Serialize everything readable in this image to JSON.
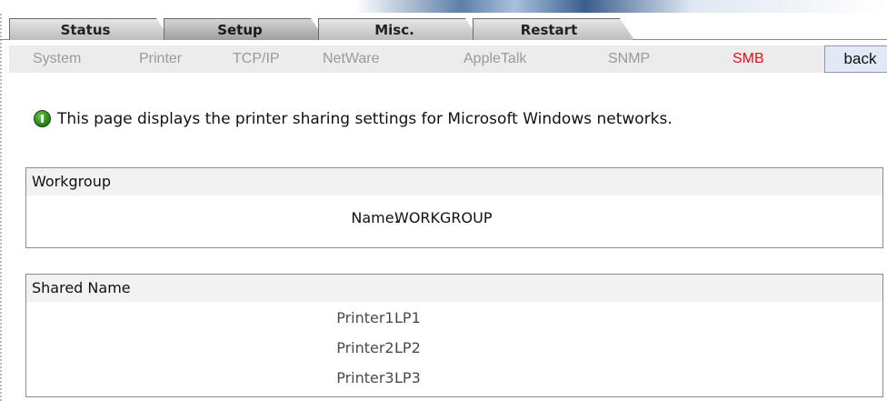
{
  "tabs": [
    {
      "label": "Status",
      "active": false
    },
    {
      "label": "Setup",
      "active": true
    },
    {
      "label": "Misc.",
      "active": false
    },
    {
      "label": "Restart",
      "active": false
    }
  ],
  "subnav": {
    "items": [
      "System",
      "Printer",
      "TCP/IP",
      "NetWare",
      "AppleTalk",
      "SNMP",
      "SMB"
    ],
    "current": "SMB",
    "back_label": "back"
  },
  "info": {
    "icon": "info-icon",
    "text": "This page displays the printer sharing settings for Microsoft Windows networks."
  },
  "workgroup": {
    "title": "Workgroup",
    "name_label": "Name:",
    "name_value": "WORKGROUP"
  },
  "shared": {
    "title": "Shared Name",
    "printers": [
      {
        "label": "Printer1:",
        "value": "LP1"
      },
      {
        "label": "Printer2:",
        "value": "LP2"
      },
      {
        "label": "Printer3:",
        "value": "LP3"
      }
    ]
  },
  "colors": {
    "accent_current": "#d8141e",
    "subnav_inactive": "#9a9a9a",
    "back_button_bg": "#e2e8f5"
  }
}
